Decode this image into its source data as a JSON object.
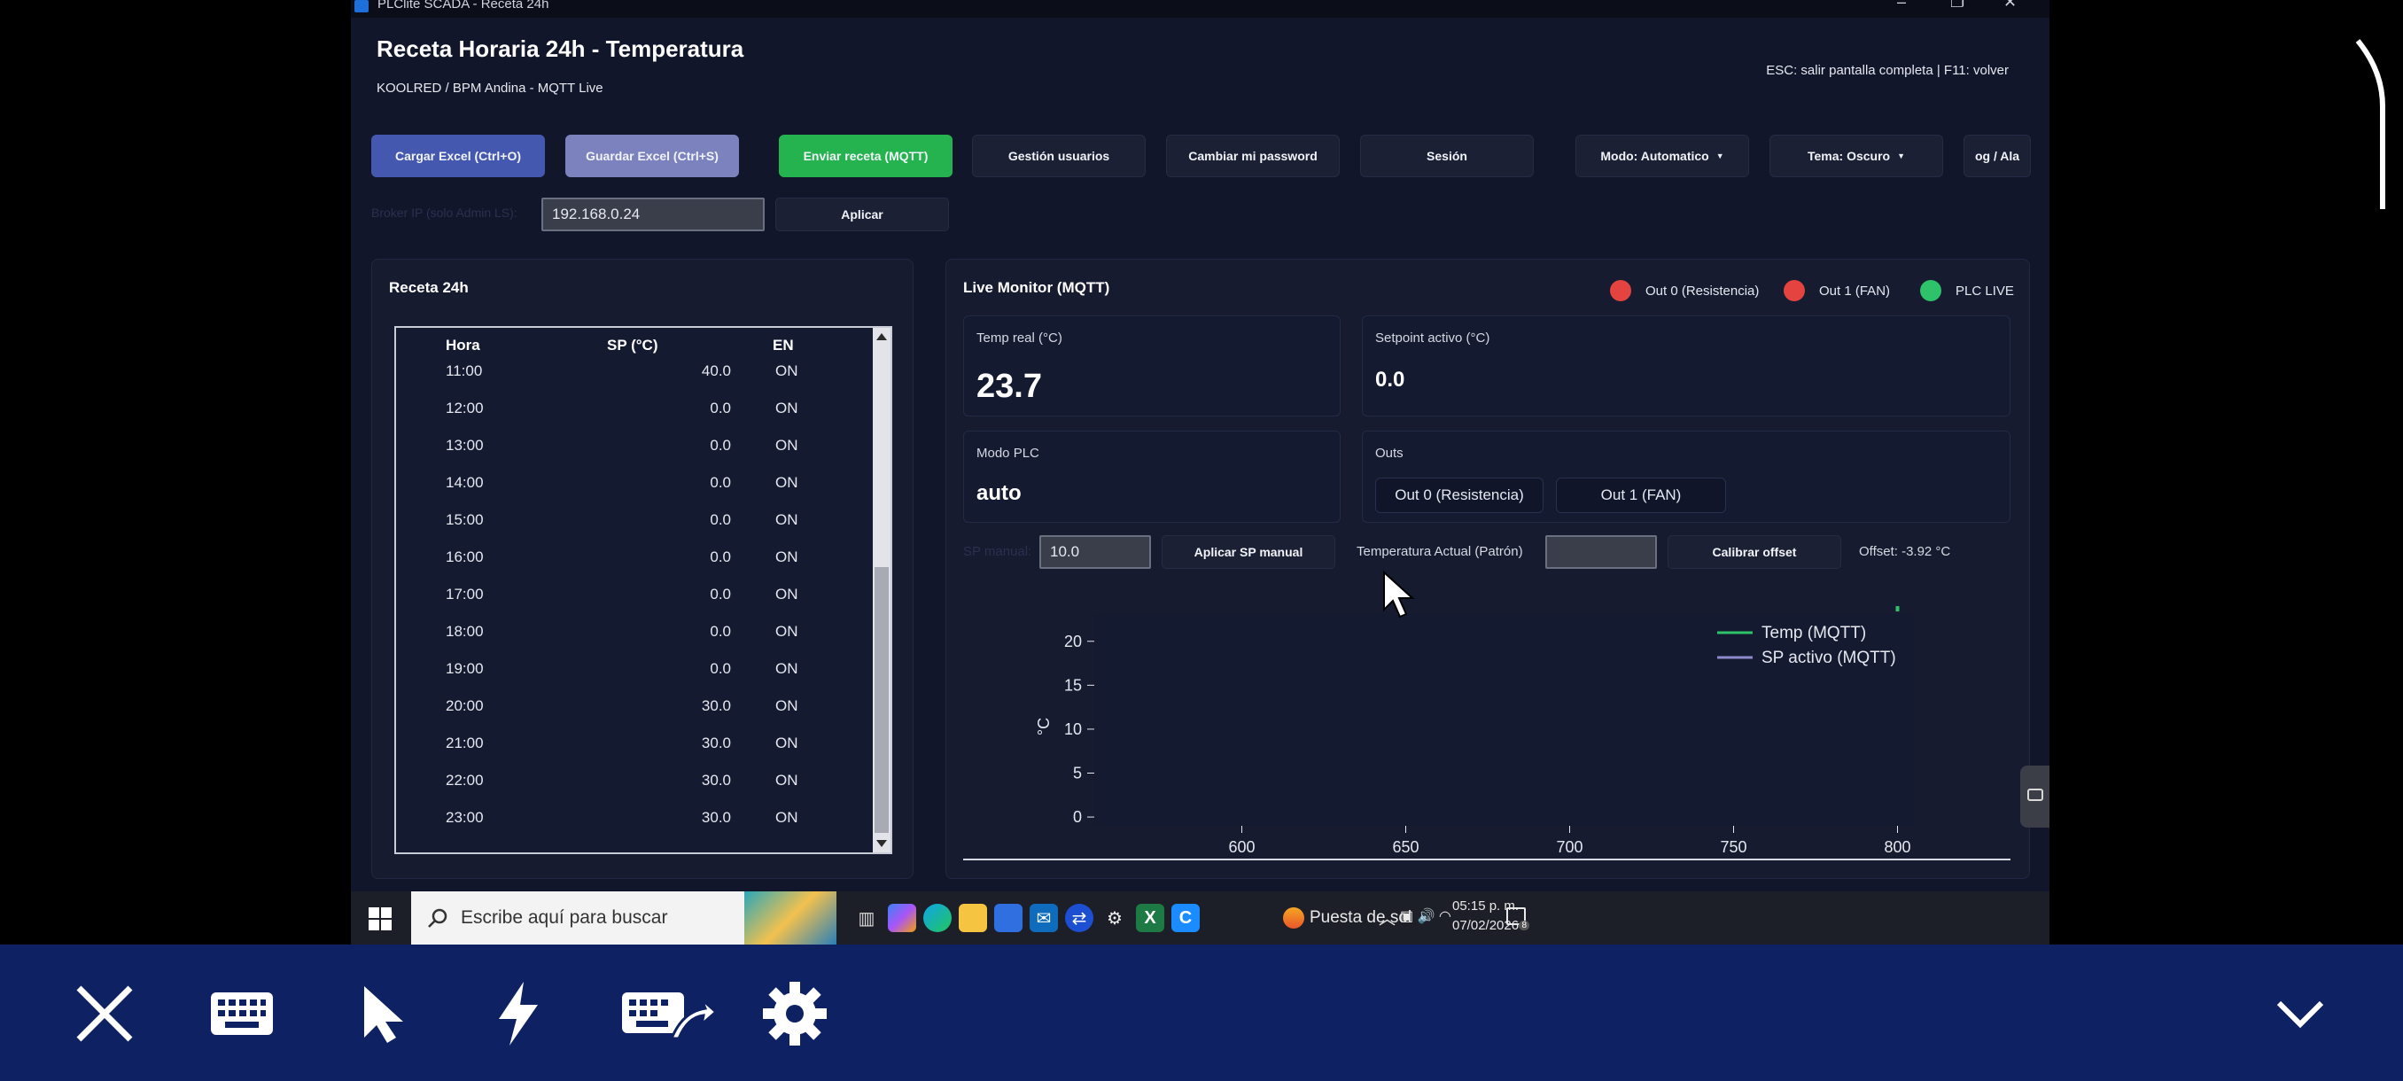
{
  "window": {
    "title": "PLClite SCADA - Receta 24h"
  },
  "header": {
    "title": "Receta Horaria 24h - Temperatura",
    "subtitle": "KOOLRED / BPM Andina - MQTT Live",
    "hint": "ESC: salir pantalla completa   |   F11: volver"
  },
  "toolbar": {
    "load_excel": "Cargar Excel (Ctrl+O)",
    "save_excel": "Guardar Excel (Ctrl+S)",
    "send_recipe": "Enviar receta (MQTT)",
    "users": "Gestión usuarios",
    "change_password": "Cambiar mi password",
    "session": "Sesión",
    "mode": "Modo: Automatico",
    "theme": "Tema: Oscuro",
    "log": "og / Ala"
  },
  "broker": {
    "label": "Broker IP (solo Admin LS):",
    "ip": "192.168.0.24",
    "apply": "Aplicar"
  },
  "recipe": {
    "title": "Receta 24h",
    "columns": [
      "Hora",
      "SP (°C)",
      "EN"
    ],
    "rows": [
      {
        "hora": "11:00",
        "sp": "40.0",
        "en": "ON"
      },
      {
        "hora": "12:00",
        "sp": "0.0",
        "en": "ON"
      },
      {
        "hora": "13:00",
        "sp": "0.0",
        "en": "ON"
      },
      {
        "hora": "14:00",
        "sp": "0.0",
        "en": "ON"
      },
      {
        "hora": "15:00",
        "sp": "0.0",
        "en": "ON"
      },
      {
        "hora": "16:00",
        "sp": "0.0",
        "en": "ON"
      },
      {
        "hora": "17:00",
        "sp": "0.0",
        "en": "ON"
      },
      {
        "hora": "18:00",
        "sp": "0.0",
        "en": "ON"
      },
      {
        "hora": "19:00",
        "sp": "0.0",
        "en": "ON"
      },
      {
        "hora": "20:00",
        "sp": "30.0",
        "en": "ON"
      },
      {
        "hora": "21:00",
        "sp": "30.0",
        "en": "ON"
      },
      {
        "hora": "22:00",
        "sp": "30.0",
        "en": "ON"
      },
      {
        "hora": "23:00",
        "sp": "30.0",
        "en": "ON"
      }
    ]
  },
  "monitor": {
    "title": "Live Monitor (MQTT)",
    "legend": [
      {
        "label": "Out 0 (Resistencia)",
        "color": "#e5433f"
      },
      {
        "label": "Out 1 (FAN)",
        "color": "#e5433f"
      },
      {
        "label": "PLC LIVE",
        "color": "#2ec26a"
      }
    ],
    "temp_label": "Temp real (°C)",
    "temp_value": "23.7",
    "setpoint_label": "Setpoint activo (°C)",
    "setpoint_value": "0.0",
    "mode_label": "Modo PLC",
    "mode_value": "auto",
    "outs_label": "Outs",
    "out0": "Out 0 (Resistencia)",
    "out1": "Out 1 (FAN)",
    "sp_manual_label": "SP manual:",
    "sp_manual_value": "10.0",
    "apply_sp": "Aplicar SP manual",
    "temp_actual_label": "Temperatura Actual (Patrón)",
    "temp_actual_value": "",
    "calibrate": "Calibrar offset",
    "offset": "Offset: -3.92 °C"
  },
  "chart_data": {
    "type": "line",
    "ylabel": "°C",
    "xlabel": "",
    "xlim": [
      555,
      805
    ],
    "ylim": [
      -1,
      23
    ],
    "x_ticks": [
      600,
      650,
      700,
      750,
      800
    ],
    "y_ticks": [
      0,
      5,
      10,
      15,
      20
    ],
    "series": [
      {
        "name": "Temp (MQTT)",
        "color": "#2ec26a",
        "x": [
          800
        ],
        "y": [
          23.7
        ]
      },
      {
        "name": "SP activo (MQTT)",
        "color": "#8e88cc",
        "x": [],
        "y": []
      }
    ],
    "legend": "top-right"
  },
  "taskbar": {
    "search_placeholder": "Escribe aquí para buscar",
    "weather": "Puesta de sol",
    "time": "05:15 p. m.",
    "date": "07/02/2026",
    "notifications": "8"
  },
  "remote_toolbar": {
    "icons": [
      "close-icon",
      "keyboard-icon",
      "pointer-icon",
      "lightning-icon",
      "keyboard-shortcut-icon",
      "settings-icon",
      "chevron-down-icon"
    ]
  }
}
